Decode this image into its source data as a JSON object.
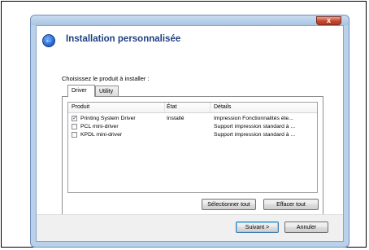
{
  "window": {
    "close_glyph": "x",
    "title": "Installation personnalisée"
  },
  "instruction": "Choisissez le produit à installer :",
  "tabs": [
    {
      "label": "Driver",
      "active": true
    },
    {
      "label": "Utility",
      "active": false
    }
  ],
  "list": {
    "columns": [
      "Produit",
      "État",
      "Détails"
    ],
    "rows": [
      {
        "checked": true,
        "product": "Printing System Driver",
        "state": "Installé",
        "details": "Impression Fonctionnalités éte..."
      },
      {
        "checked": false,
        "product": "PCL mini-driver",
        "state": "",
        "details": "Support impression standard à ..."
      },
      {
        "checked": false,
        "product": "KPDL mini-driver",
        "state": "",
        "details": "Support impression standard à ..."
      }
    ]
  },
  "buttons": {
    "select_all": "Sélectionner tout",
    "clear_all": "Effacer tout",
    "next": "Suivant >",
    "cancel": "Annuler"
  },
  "icons": {
    "back": "back-arrow-icon",
    "close": "close-icon",
    "check": "checkmark-icon"
  }
}
